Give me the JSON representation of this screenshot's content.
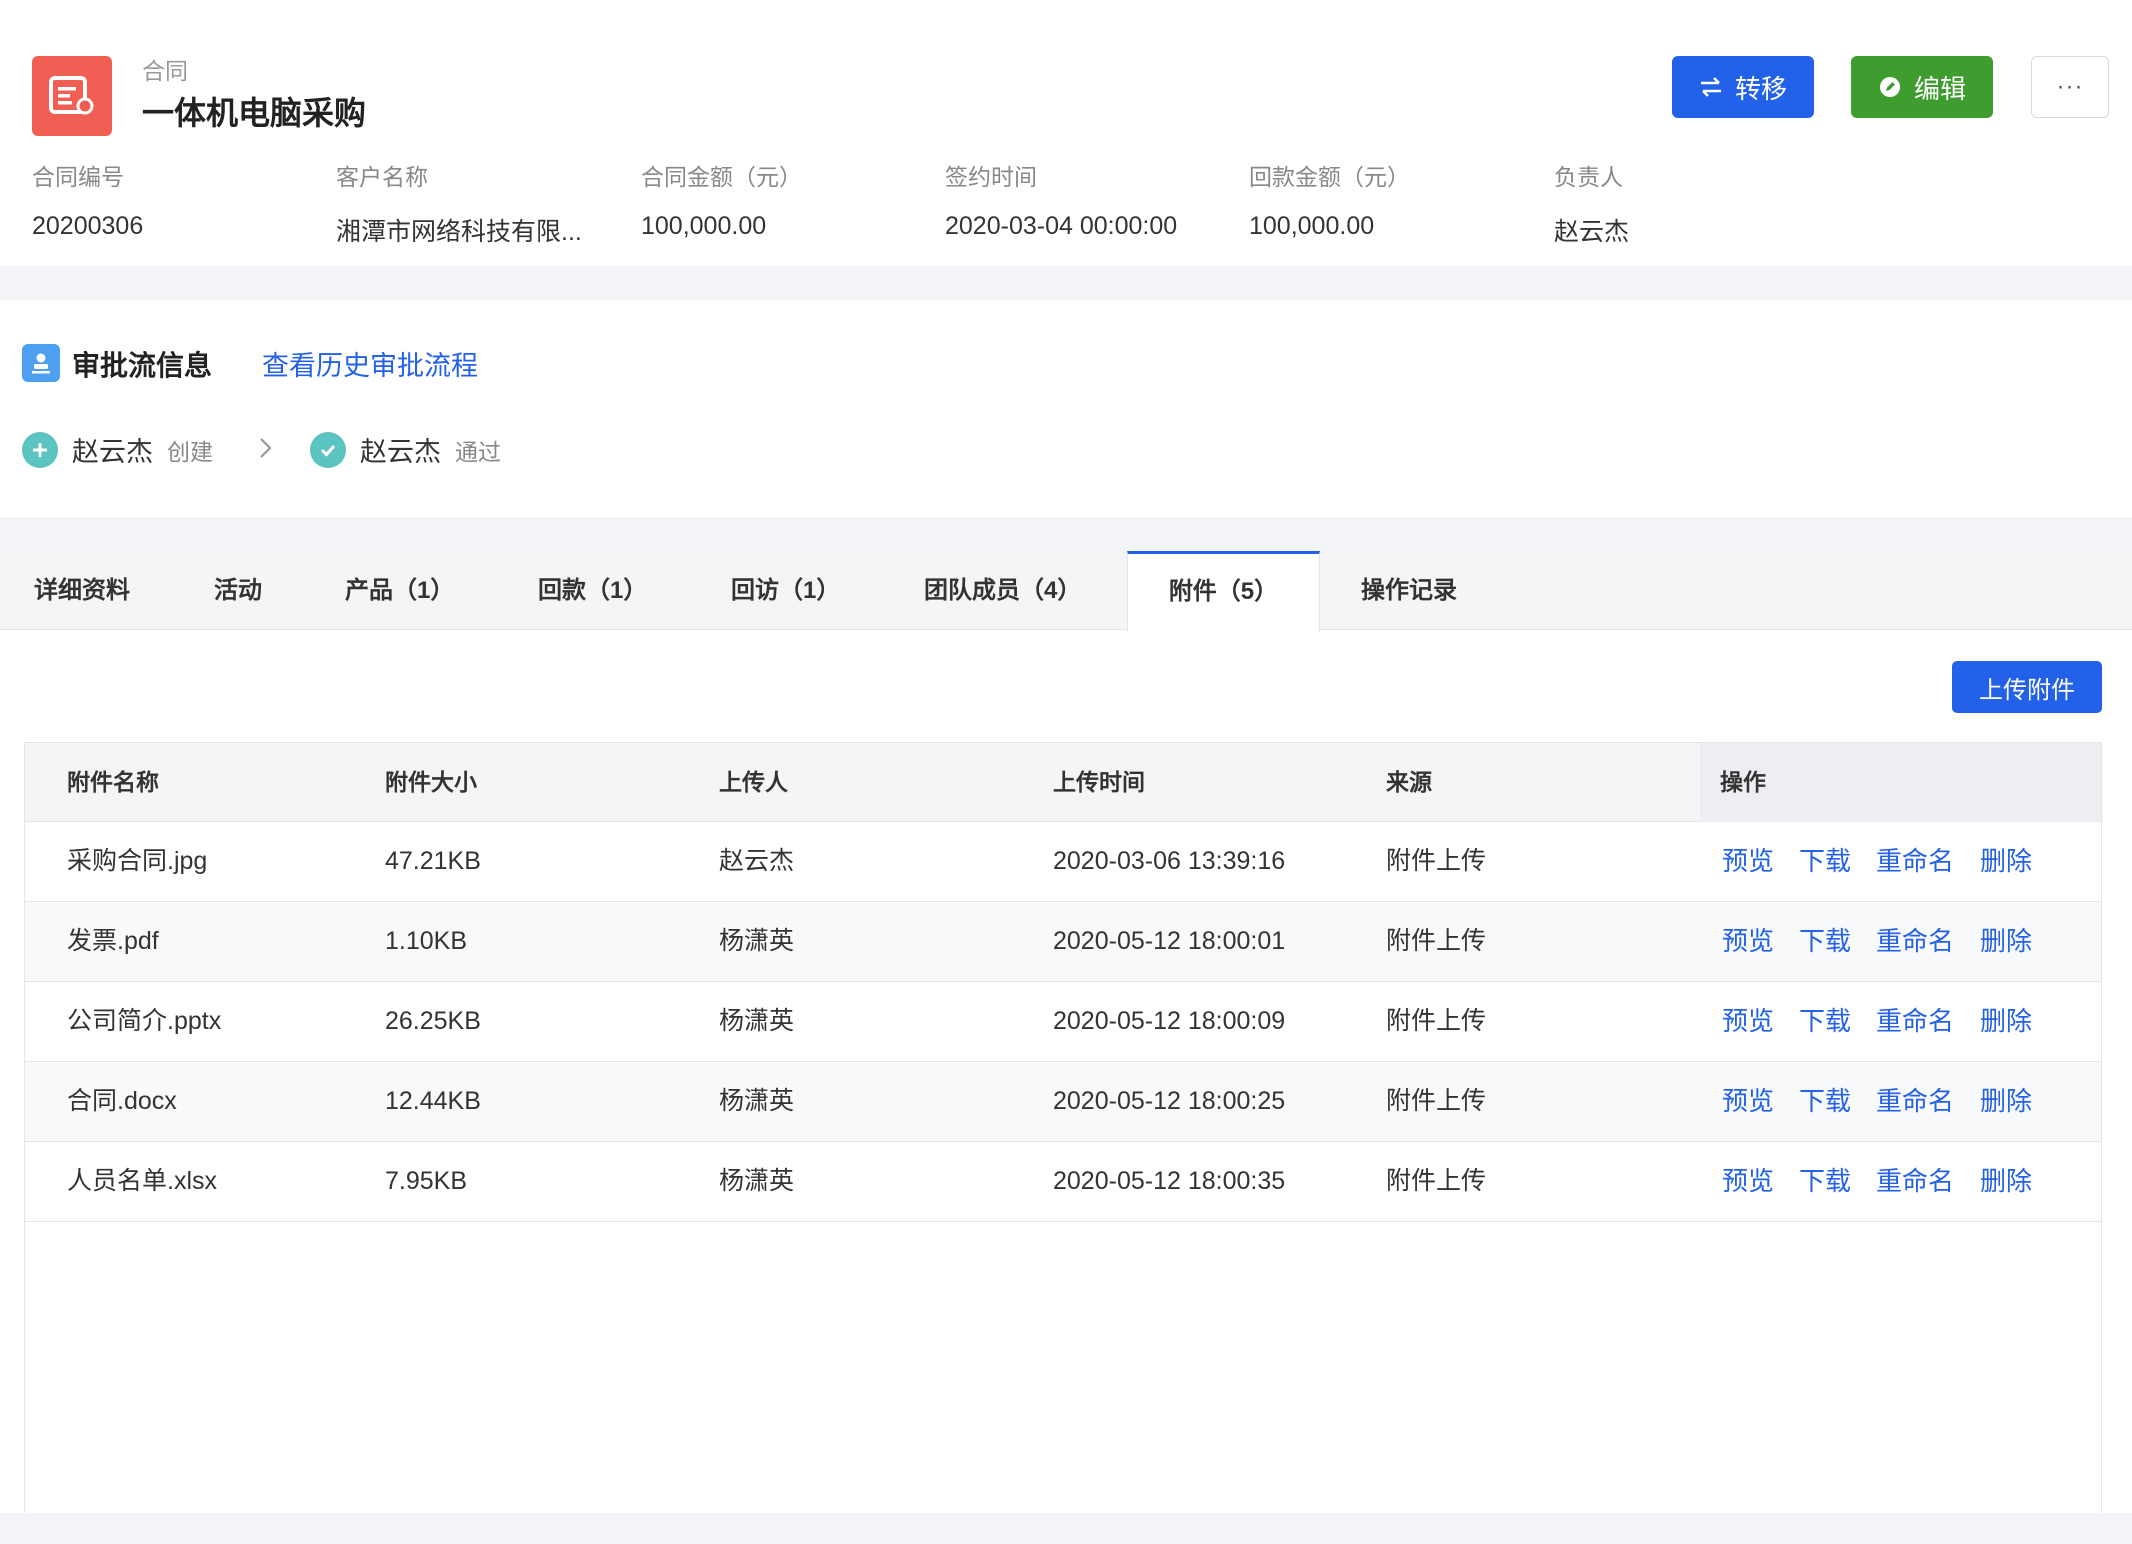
{
  "header": {
    "crumb": "合同",
    "title": "一体机电脑采购",
    "transfer_label": "转移",
    "edit_label": "编辑",
    "more_label": "···",
    "fields": [
      {
        "label": "合同编号",
        "value": "20200306"
      },
      {
        "label": "客户名称",
        "value": "湘潭市网络科技有限..."
      },
      {
        "label": "合同金额（元）",
        "value": "100,000.00"
      },
      {
        "label": "签约时间",
        "value": "2020-03-04 00:00:00"
      },
      {
        "label": "回款金额（元）",
        "value": "100,000.00"
      },
      {
        "label": "负责人",
        "value": "赵云杰"
      }
    ]
  },
  "approval": {
    "title": "审批流信息",
    "history_link": "查看历史审批流程",
    "steps": [
      {
        "name": "赵云杰",
        "state": "创建"
      },
      {
        "name": "赵云杰",
        "state": "通过"
      }
    ]
  },
  "tabs": [
    {
      "label": "详细资料"
    },
    {
      "label": "活动"
    },
    {
      "label": "产品（1）"
    },
    {
      "label": "回款（1）"
    },
    {
      "label": "回访（1）"
    },
    {
      "label": "团队成员（4）"
    },
    {
      "label": "附件（5）",
      "active": true
    },
    {
      "label": "操作记录"
    }
  ],
  "attachments": {
    "upload_label": "上传附件",
    "columns": [
      "附件名称",
      "附件大小",
      "上传人",
      "上传时间",
      "来源",
      "操作"
    ],
    "rows": [
      {
        "name": "采购合同.jpg",
        "size": "47.21KB",
        "uploader": "赵云杰",
        "time": "2020-03-06 13:39:16",
        "source": "附件上传"
      },
      {
        "name": "发票.pdf",
        "size": "1.10KB",
        "uploader": "杨潇英",
        "time": "2020-05-12 18:00:01",
        "source": "附件上传"
      },
      {
        "name": "公司简介.pptx",
        "size": "26.25KB",
        "uploader": "杨潇英",
        "time": "2020-05-12 18:00:09",
        "source": "附件上传"
      },
      {
        "name": "合同.docx",
        "size": "12.44KB",
        "uploader": "杨潇英",
        "time": "2020-05-12 18:00:25",
        "source": "附件上传"
      },
      {
        "name": "人员名单.xlsx",
        "size": "7.95KB",
        "uploader": "杨潇英",
        "time": "2020-05-12 18:00:35",
        "source": "附件上传"
      }
    ],
    "actions": [
      "预览",
      "下载",
      "重命名",
      "删除"
    ]
  },
  "colors": {
    "primary": "#2362e8",
    "success": "#3f9d2f",
    "contract_icon": "#f05e54",
    "flow_icon": "#5bc3c0"
  }
}
